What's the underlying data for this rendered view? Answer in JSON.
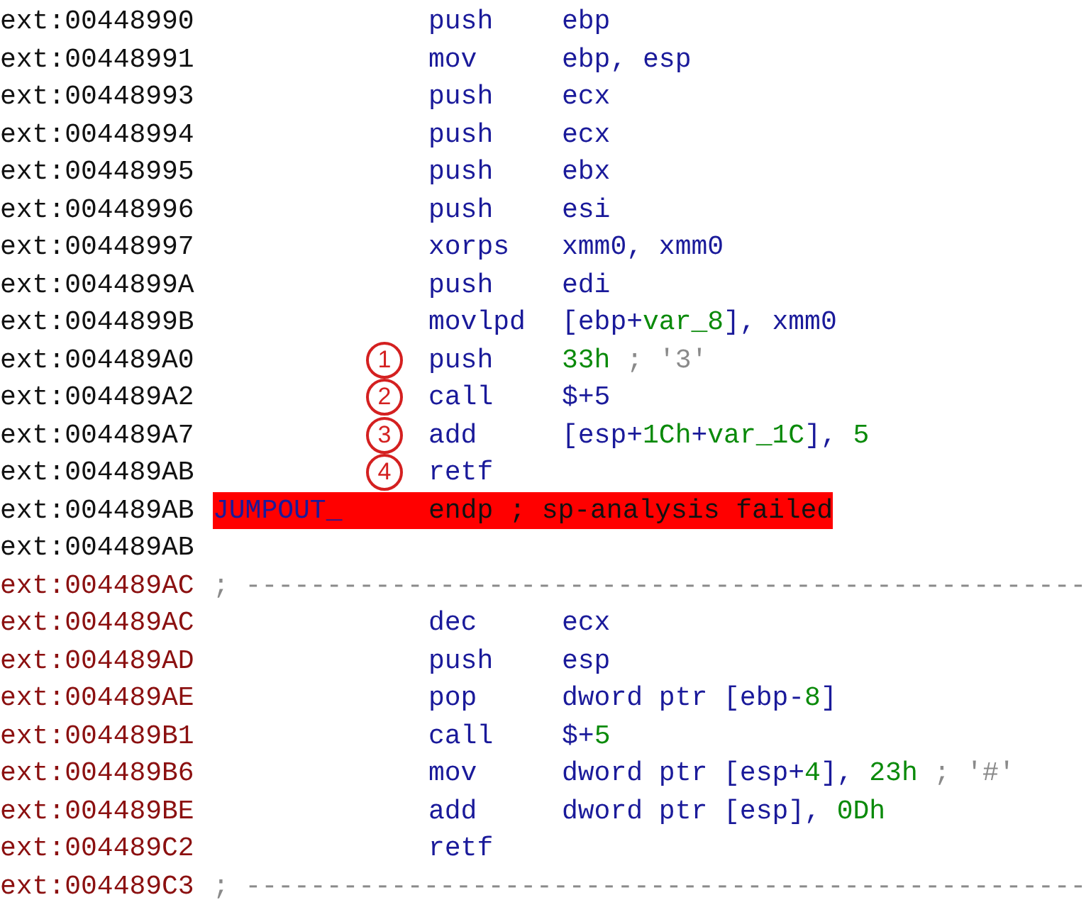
{
  "rows": [
    {
      "address": "ext:00448990",
      "kind": "code",
      "mnemonic": "push",
      "operands": [
        {
          "text": "ebp",
          "kind": "reg"
        }
      ]
    },
    {
      "address": "ext:00448991",
      "kind": "code",
      "mnemonic": "mov",
      "operands": [
        {
          "text": "ebp, esp",
          "kind": "reg"
        }
      ]
    },
    {
      "address": "ext:00448993",
      "kind": "code",
      "mnemonic": "push",
      "operands": [
        {
          "text": "ecx",
          "kind": "reg"
        }
      ]
    },
    {
      "address": "ext:00448994",
      "kind": "code",
      "mnemonic": "push",
      "operands": [
        {
          "text": "ecx",
          "kind": "reg"
        }
      ]
    },
    {
      "address": "ext:00448995",
      "kind": "code",
      "mnemonic": "push",
      "operands": [
        {
          "text": "ebx",
          "kind": "reg"
        }
      ]
    },
    {
      "address": "ext:00448996",
      "kind": "code",
      "mnemonic": "push",
      "operands": [
        {
          "text": "esi",
          "kind": "reg"
        }
      ]
    },
    {
      "address": "ext:00448997",
      "kind": "code",
      "mnemonic": "xorps",
      "operands": [
        {
          "text": "xmm0, xmm0",
          "kind": "reg"
        }
      ]
    },
    {
      "address": "ext:0044899A",
      "kind": "code",
      "mnemonic": "push",
      "operands": [
        {
          "text": "edi",
          "kind": "reg"
        }
      ]
    },
    {
      "address": "ext:0044899B",
      "kind": "code",
      "mnemonic": "movlpd",
      "operands": [
        {
          "text": "[ebp+",
          "kind": "reg"
        },
        {
          "text": "var_8",
          "kind": "num"
        },
        {
          "text": "], xmm0",
          "kind": "reg"
        }
      ]
    },
    {
      "address": "ext:004489A0",
      "kind": "code",
      "marker": "1",
      "mnemonic": "push",
      "operands": [
        {
          "text": "33h",
          "kind": "num"
        },
        {
          "text": " ; '3'",
          "kind": "comment"
        }
      ]
    },
    {
      "address": "ext:004489A2",
      "kind": "code",
      "marker": "2",
      "mnemonic": "call",
      "operands": [
        {
          "text": "$+5",
          "kind": "reg"
        }
      ]
    },
    {
      "address": "ext:004489A7",
      "kind": "code",
      "marker": "3",
      "mnemonic": "add",
      "operands": [
        {
          "text": "[esp+",
          "kind": "reg"
        },
        {
          "text": "1Ch",
          "kind": "num"
        },
        {
          "text": "+",
          "kind": "reg"
        },
        {
          "text": "var_1C",
          "kind": "num"
        },
        {
          "text": "], ",
          "kind": "reg"
        },
        {
          "text": "5",
          "kind": "num"
        }
      ]
    },
    {
      "address": "ext:004489AB",
      "kind": "code",
      "marker": "4",
      "mnemonic": "retf"
    },
    {
      "address": "ext:004489AB",
      "kind": "code",
      "highlighted": true,
      "label": "JUMPOUT_",
      "mnemonic": "endp ; sp-analysis failed"
    },
    {
      "address": "ext:004489AB",
      "kind": "code"
    },
    {
      "address": "ext:004489AC",
      "kind": "data",
      "separator": "; ----------------------------------------------------"
    },
    {
      "address": "ext:004489AC",
      "kind": "data",
      "mnemonic": "dec",
      "operands": [
        {
          "text": "ecx",
          "kind": "reg"
        }
      ]
    },
    {
      "address": "ext:004489AD",
      "kind": "data",
      "mnemonic": "push",
      "operands": [
        {
          "text": "esp",
          "kind": "reg"
        }
      ]
    },
    {
      "address": "ext:004489AE",
      "kind": "data",
      "mnemonic": "pop",
      "operands": [
        {
          "text": "dword ptr [ebp-",
          "kind": "reg"
        },
        {
          "text": "8",
          "kind": "num"
        },
        {
          "text": "]",
          "kind": "reg"
        }
      ]
    },
    {
      "address": "ext:004489B1",
      "kind": "data",
      "mnemonic": "call",
      "operands": [
        {
          "text": "$+",
          "kind": "reg"
        },
        {
          "text": "5",
          "kind": "num"
        }
      ]
    },
    {
      "address": "ext:004489B6",
      "kind": "data",
      "mnemonic": "mov",
      "operands": [
        {
          "text": "dword ptr [esp+",
          "kind": "reg"
        },
        {
          "text": "4",
          "kind": "num"
        },
        {
          "text": "], ",
          "kind": "reg"
        },
        {
          "text": "23h",
          "kind": "num"
        },
        {
          "text": " ; '#'",
          "kind": "comment"
        }
      ]
    },
    {
      "address": "ext:004489BE",
      "kind": "data",
      "mnemonic": "add",
      "operands": [
        {
          "text": "dword ptr [esp], ",
          "kind": "reg"
        },
        {
          "text": "0Dh",
          "kind": "num"
        }
      ]
    },
    {
      "address": "ext:004489C2",
      "kind": "data",
      "mnemonic": "retf"
    },
    {
      "address": "ext:004489C3",
      "kind": "data",
      "separator": "; ----------------------------------------------------"
    }
  ]
}
